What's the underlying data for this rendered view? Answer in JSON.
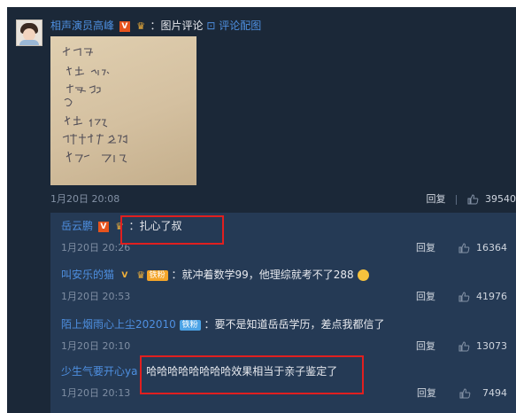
{
  "post": {
    "username": "相声演员高峰",
    "v_badge": "V",
    "type_label": "：图片评论",
    "link_label": "评论配图",
    "time": "1月20日 20:08",
    "reply_label": "回复",
    "like_count": "39540"
  },
  "note": {
    "lines": [
      "岳龙刚",
      "语文  134",
      "数学  99",
      "",
      "外语  145",
      "理科综合  288",
      "总分   702"
    ]
  },
  "comments": [
    {
      "username": "岳云鹏",
      "badge_v": "V",
      "fan_badge": "",
      "text": "：扎心了叔",
      "time": "1月20日 20:26",
      "reply_label": "回复",
      "like_count": "16364"
    },
    {
      "username": "叫安乐的猫",
      "badge_v": "V",
      "fan_badge": "铁粉",
      "text": "：就冲着数学99，他理综就考不了288",
      "time": "1月20日 20:53",
      "reply_label": "回复",
      "like_count": "41976"
    },
    {
      "username": "陌上烟雨心上尘202010",
      "badge_v": "",
      "fan_badge": "铁粉",
      "text": "：要不是知道岳岳学历，差点我都信了",
      "time": "1月20日 20:10",
      "reply_label": "回复",
      "like_count": "13073"
    },
    {
      "username": "少生气要开心ya",
      "badge_v": "",
      "fan_badge": "",
      "text": "哈哈哈哈哈哈哈哈效果相当于亲子鉴定了",
      "time": "1月20日 20:13",
      "reply_label": "回复",
      "like_count": "7494"
    }
  ],
  "colors": {
    "panel_bg": "#1b2838",
    "comments_bg": "#253a55",
    "link_blue": "#4e8fe0",
    "highlight_red": "#e11f1f"
  }
}
